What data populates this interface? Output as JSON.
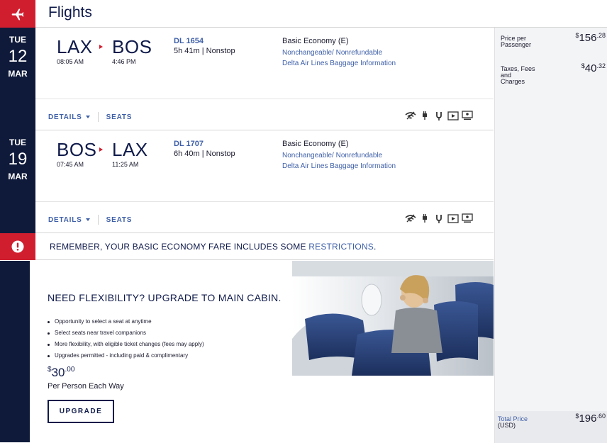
{
  "header": {
    "title": "Flights"
  },
  "flights": [
    {
      "dow": "TUE",
      "day": "12",
      "month": "MAR",
      "origin": "LAX",
      "origin_time": "08:05 AM",
      "dest": "BOS",
      "dest_time": "4:46 PM",
      "flight_number": "DL 1654",
      "duration": "5h 41m | Nonstop",
      "fare_class": "Basic Economy (E)",
      "rule_link": "Nonchangeable/ Nonrefundable",
      "baggage_link": "Delta Air Lines Baggage Information",
      "details_label": "DETAILS",
      "seats_label": "SEATS"
    },
    {
      "dow": "TUE",
      "day": "19",
      "month": "MAR",
      "origin": "BOS",
      "origin_time": "07:45 AM",
      "dest": "LAX",
      "dest_time": "11:25 AM",
      "flight_number": "DL 1707",
      "duration": "6h 40m | Nonstop",
      "fare_class": "Basic Economy (E)",
      "rule_link": "Nonchangeable/ Nonrefundable",
      "baggage_link": "Delta Air Lines Baggage Information",
      "details_label": "DETAILS",
      "seats_label": "SEATS"
    }
  ],
  "amenity_icons": [
    "wifi-icon",
    "power-outlet-icon",
    "usb-power-icon",
    "entertainment-icon",
    "seatback-screen-icon"
  ],
  "restriction": {
    "message": "REMEMBER, YOUR BASIC ECONOMY FARE INCLUDES SOME",
    "link": "RESTRICTIONS",
    "suffix": "."
  },
  "upgrade": {
    "heading": "NEED FLEXIBILITY? UPGRADE TO MAIN CABIN.",
    "bullets": [
      "Opportunity to select a seat at anytime",
      "Select seats near travel companions",
      "More flexibility, with eligible ticket changes (fees may apply)",
      "Upgrades permitted - including paid & complimentary"
    ],
    "price_currency": "$",
    "price_whole": "30",
    "price_cents": ".00",
    "per_label": "Per Person Each Way",
    "button_label": "UPGRADE"
  },
  "pricing": {
    "per_passenger_label": "Price per Passenger",
    "per_passenger": {
      "cur": "$",
      "whole": "156",
      "cents": ".28"
    },
    "taxes_label": "Taxes, Fees and Charges",
    "taxes": {
      "cur": "$",
      "whole": "40",
      "cents": ".32"
    },
    "total_label": "Total Price",
    "total_currency_label": "(USD)",
    "total": {
      "cur": "$",
      "whole": "196",
      "cents": ".60"
    }
  },
  "colors": {
    "navy": "#0f1a3a",
    "red": "#d01e2f",
    "link": "#3e5fa8"
  }
}
